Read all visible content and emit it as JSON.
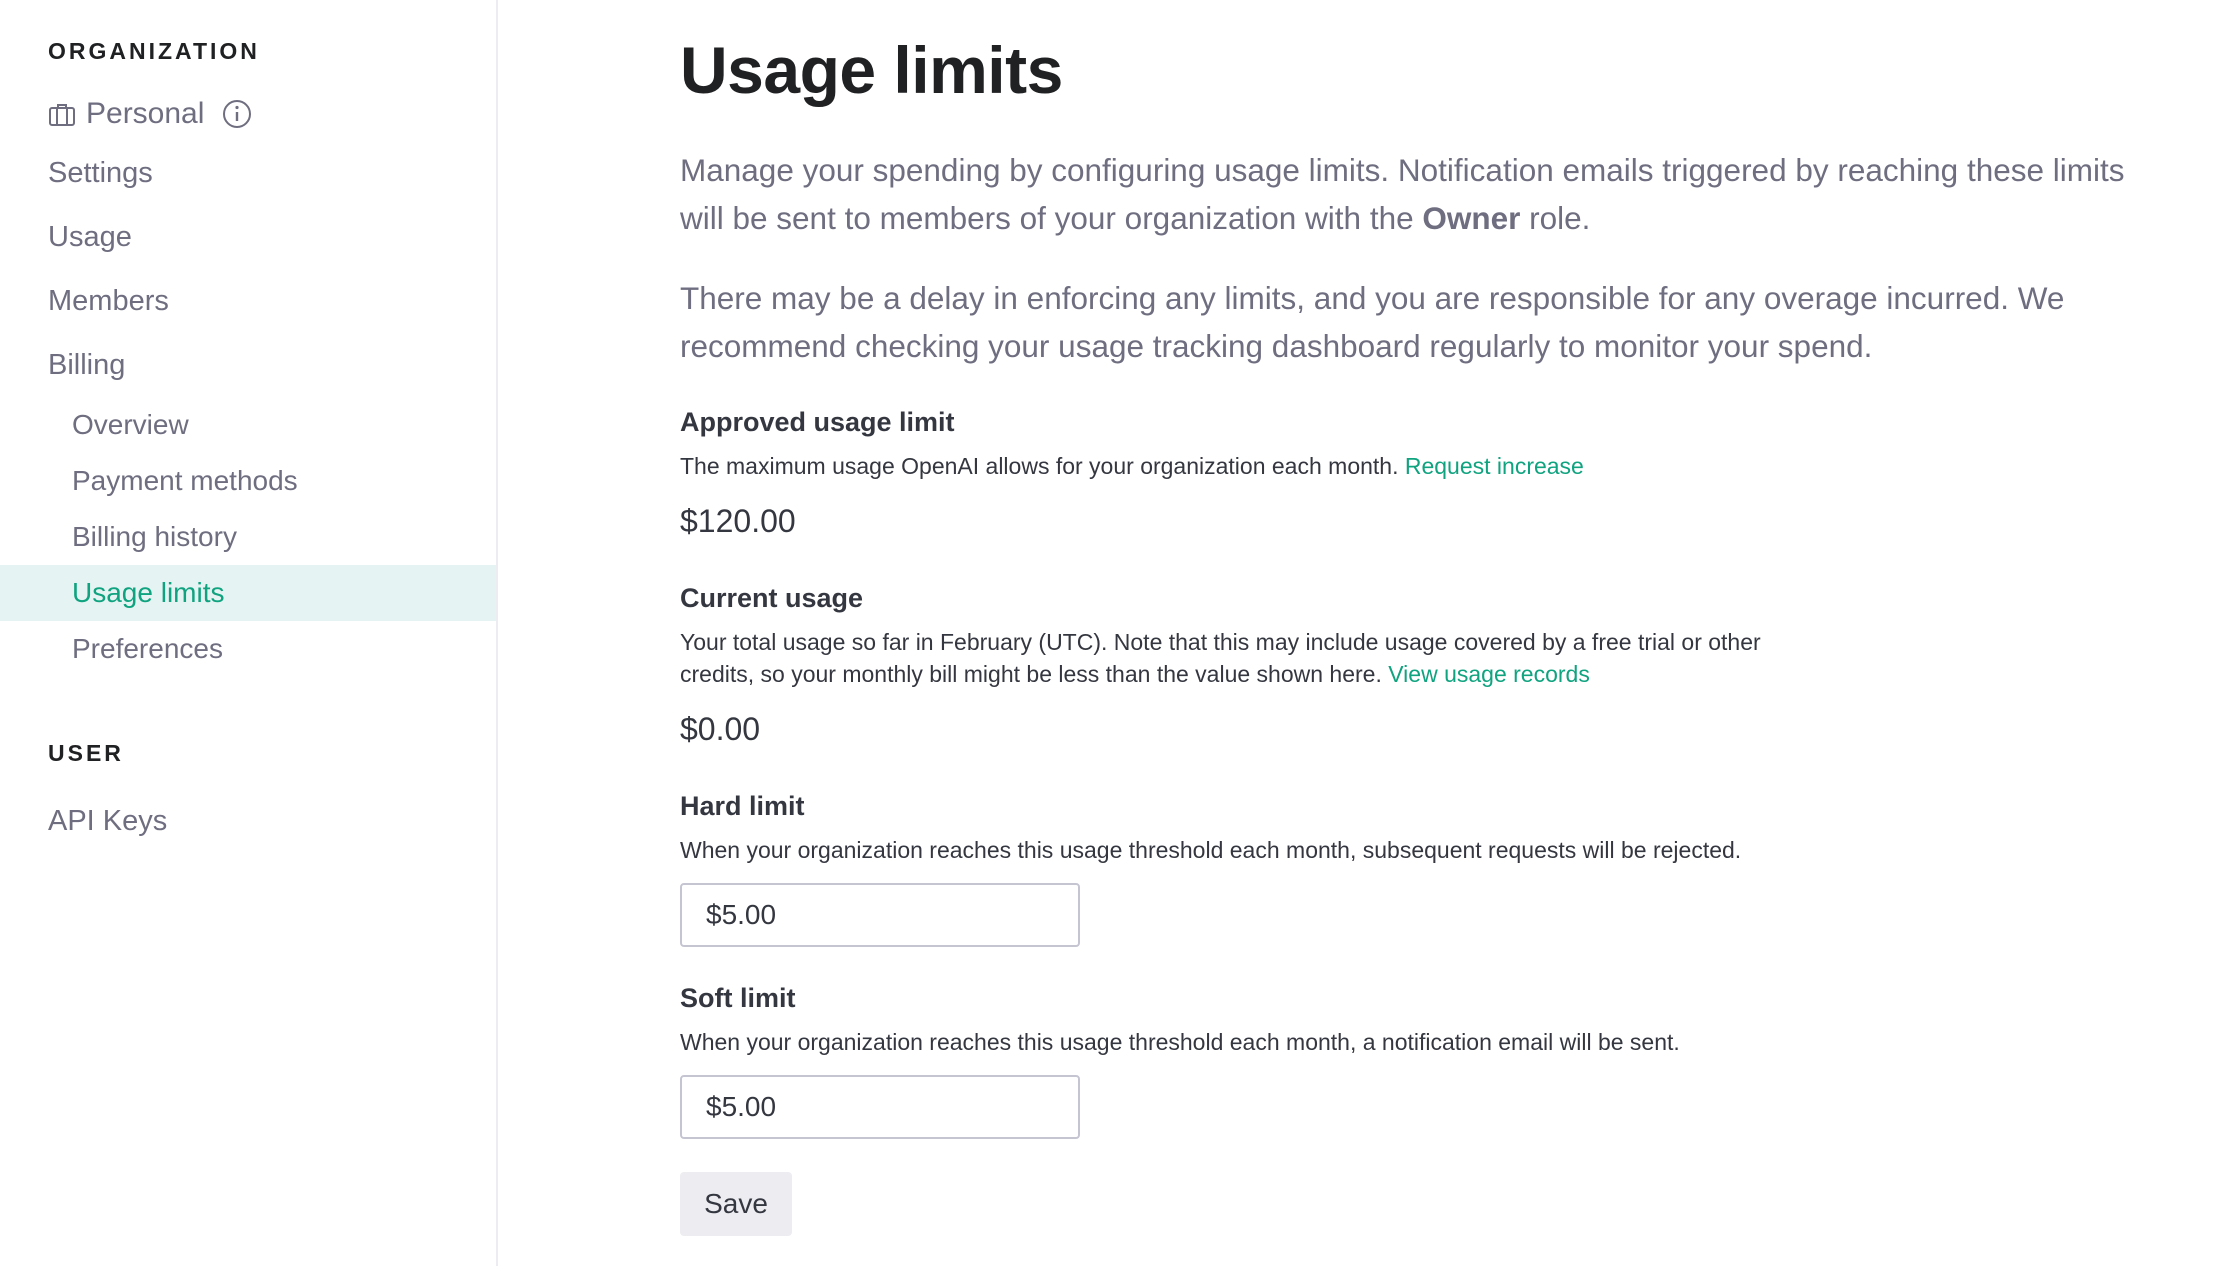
{
  "sidebar": {
    "org_heading": "ORGANIZATION",
    "org_name": "Personal",
    "items": {
      "settings": "Settings",
      "usage": "Usage",
      "members": "Members",
      "billing": "Billing"
    },
    "billing_sub": {
      "overview": "Overview",
      "payment_methods": "Payment methods",
      "billing_history": "Billing history",
      "usage_limits": "Usage limits",
      "preferences": "Preferences"
    },
    "user_heading": "USER",
    "api_keys": "API Keys"
  },
  "main": {
    "title": "Usage limits",
    "intro1_before": "Manage your spending by configuring usage limits. Notification emails triggered by reaching these limits will be sent to members of your organization with the ",
    "intro1_bold": "Owner",
    "intro1_after": " role.",
    "intro2": "There may be a delay in enforcing any limits, and you are responsible for any overage incurred. We recommend checking your usage tracking dashboard regularly to monitor your spend.",
    "approved": {
      "title": "Approved usage limit",
      "desc": "The maximum usage OpenAI allows for your organization each month. ",
      "link": "Request increase",
      "value": "$120.00"
    },
    "current": {
      "title": "Current usage",
      "desc": "Your total usage so far in February (UTC). Note that this may include usage covered by a free trial or other credits, so your monthly bill might be less than the value shown here. ",
      "link": "View usage records",
      "value": "$0.00"
    },
    "hard": {
      "title": "Hard limit",
      "desc": "When your organization reaches this usage threshold each month, subsequent requests will be rejected.",
      "value": "$5.00"
    },
    "soft": {
      "title": "Soft limit",
      "desc": "When your organization reaches this usage threshold each month, a notification email will be sent.",
      "value": "$5.00"
    },
    "save_label": "Save"
  },
  "colors": {
    "accent": "#10a37f",
    "active_bg": "#e6f3f3",
    "muted_text": "#6e6e80"
  },
  "icons": {
    "org": "briefcase-icon",
    "info": "info-icon"
  }
}
